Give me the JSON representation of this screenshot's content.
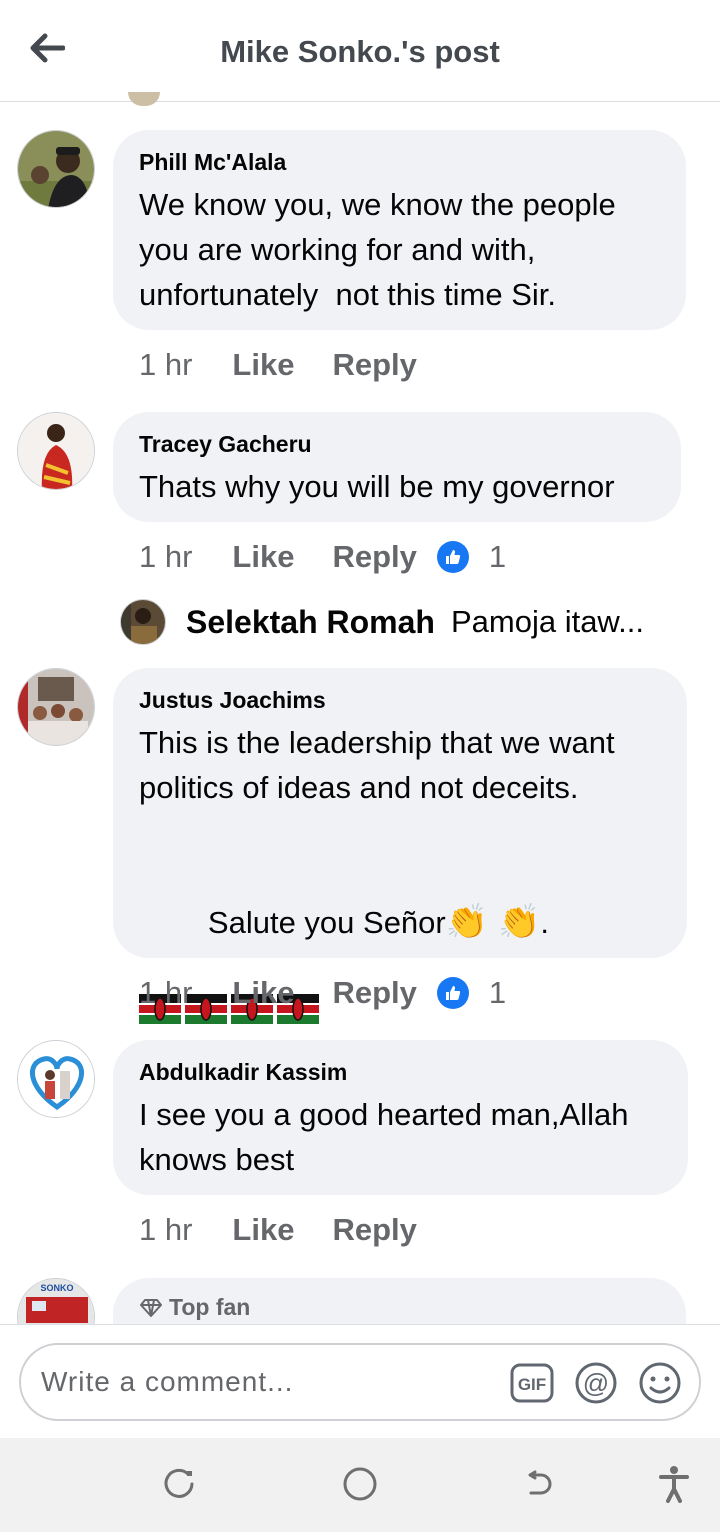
{
  "header": {
    "title": "Mike Sonko.'s post",
    "back_icon": "arrow-left-icon"
  },
  "comments": [
    {
      "author": "Phill Mc'Alala",
      "text": "We know you, we know the people you are working for and with, unfortunately  not this time Sir.",
      "time": "1 hr",
      "like_label": "Like",
      "reply_label": "Reply"
    },
    {
      "author": "Tracey Gacheru",
      "text": "Thats why you will be my governor",
      "time": "1 hr",
      "like_label": "Like",
      "reply_label": "Reply",
      "reaction_count": "1",
      "reply_preview": {
        "author": "Selektah Romah",
        "text": "Pamoja itaw..."
      }
    },
    {
      "author": "Justus Joachims",
      "text": "This is the leadership that we want politics of ideas and not deceits.",
      "text_line2": "Salute you Señor",
      "text_line2_suffix": ".",
      "time": "1 hr",
      "like_label": "Like",
      "reply_label": "Reply",
      "reaction_count": "1"
    },
    {
      "author": "Abdulkadir Kassim",
      "text": "I see you a good hearted man,Allah knows best",
      "time": "1 hr",
      "like_label": "Like",
      "reply_label": "Reply"
    },
    {
      "badge": "Top fan",
      "avatar_text": "SONKO"
    }
  ],
  "composer": {
    "placeholder": "Write a comment...",
    "gif_label": "GIF"
  },
  "colors": {
    "bubble": "#f0f2f5",
    "secondary_text": "#65676b",
    "like_blue": "#1877f2"
  }
}
